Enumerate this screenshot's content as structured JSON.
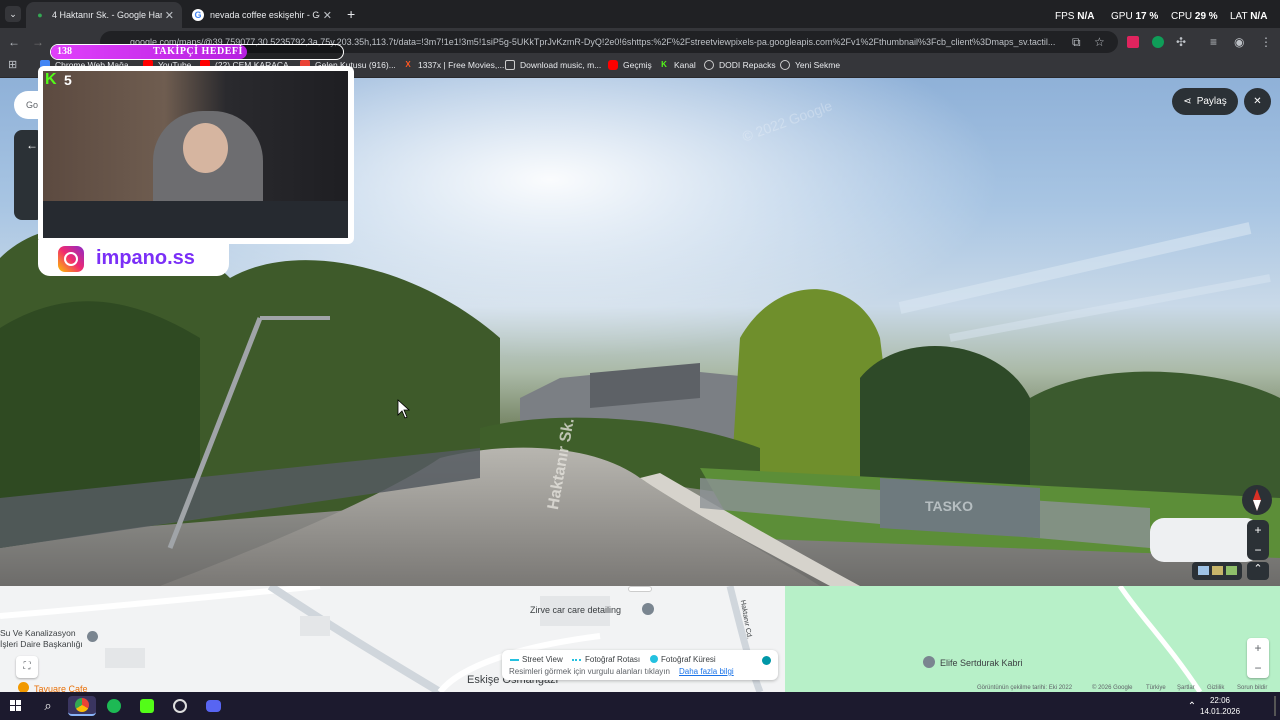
{
  "browser": {
    "tabs": [
      {
        "title": "4 Haktanır Sk. - Google Haritalar",
        "active": true
      },
      {
        "title": "nevada coffee eskişehir - Google",
        "active": false
      }
    ],
    "new_tab": "+",
    "url": "google.com/maps/@39.759077,30.5235792,3a,75y,203.35h,113.7t/data=!3m7!1e1!3m5!1siP5g-5UKkTprJvKzmR-DyQ!2e0!6shttps:%2F%2Fstreetviewpixels-pa.googleapis.com%2Fv1%2Fthumbnail%3Fcb_client%3Dmaps_sv.tactil..."
  },
  "hud": {
    "fps_label": "FPS",
    "fps_value": "N/A",
    "gpu_label": "GPU",
    "gpu_value": "17 %",
    "cpu_label": "CPU",
    "cpu_value": "29 %",
    "lat_label": "LAT",
    "lat_value": "N/A"
  },
  "bookmarks": [
    {
      "label": "Chrome Web Mağa...",
      "icon": "chrome-store-icon"
    },
    {
      "label": "YouTube",
      "icon": "youtube-icon"
    },
    {
      "label": "(22) CEM KARACA...",
      "icon": "youtube-icon"
    },
    {
      "label": "Gelen Kutusu (916)...",
      "icon": "gmail-icon"
    },
    {
      "label": "1337x | Free Movies,...",
      "icon": "1337x-icon"
    },
    {
      "label": "Download music, m...",
      "icon": "download-icon"
    },
    {
      "label": "Geçmiş",
      "icon": "youtube-icon"
    },
    {
      "label": "Kanal",
      "icon": "kick-icon"
    },
    {
      "label": "DODI Repacks",
      "icon": "globe-icon"
    },
    {
      "label": "Yeni Sekme",
      "icon": "globe-icon"
    }
  ],
  "overlay": {
    "follower_count": "138",
    "follower_goal": "TAKİPÇİ HEDEFİ",
    "kick_viewers": "5",
    "instagram_handle": "impano.ss"
  },
  "streetview": {
    "share_label": "Paylaş",
    "street_name": "Haktanır Sk.",
    "watermark": "© 2022 Google",
    "sign_text": "TASKO",
    "search_stub": "Go"
  },
  "map": {
    "places": [
      {
        "name": "Zirve car care detailing"
      },
      {
        "name": "Su Ve Kanalizasyon İşleri Daire Başkanlığı"
      },
      {
        "name": "Elife Sertdurak Kabri"
      },
      {
        "name": "Tavuare Cafe"
      },
      {
        "name": "Eskişe Osmangazi"
      },
      {
        "name": "Haktanır Cd."
      }
    ],
    "legend": {
      "street_view": "Street View",
      "photo_route": "Fotoğraf Rotası",
      "photo_sphere": "Fotoğraf Küresi",
      "hint": "Resimleri görmek için vurgulu alanları tıklayın",
      "more_info": "Daha fazla bilgi"
    },
    "footer": [
      "Görüntünün çekilme tarihi: Eki 2022",
      "© 2026 Google",
      "Türkiye",
      "Şartlar",
      "Gizlilik",
      "Sorun bildir"
    ]
  },
  "taskbar": {
    "time": "22:06",
    "date": "14.01.2026"
  },
  "colors": {
    "kick_green": "#53fc18",
    "instagram_purple": "#7b2ff7",
    "overlay_pink": "#e040fb"
  }
}
